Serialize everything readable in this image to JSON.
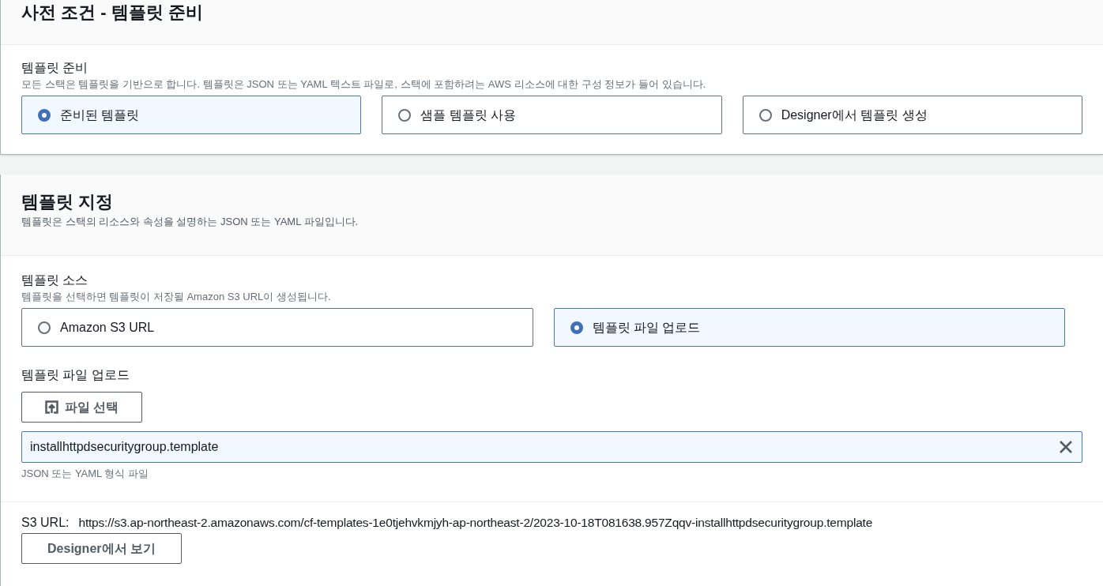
{
  "prerequisite": {
    "title": "사전 조건 - 템플릿 준비",
    "field_label": "템플릿 준비",
    "description": "모든 스택은 템플릿을 기반으로 합니다. 템플릿은 JSON 또는 YAML 텍스트 파일로, 스택에 포함하려는 AWS 리소스에 대한 구성 정보가 들어 있습니다.",
    "options": [
      {
        "label": "준비된 템플릿",
        "selected": true
      },
      {
        "label": "샘플 템플릿 사용",
        "selected": false
      },
      {
        "label": "Designer에서 템플릿 생성",
        "selected": false
      }
    ]
  },
  "specify": {
    "title": "템플릿 지정",
    "subtitle": "템플릿은 스택의 리소스와 속성을 설명하는 JSON 또는 YAML 파일입니다.",
    "source_label": "템플릿 소스",
    "source_description": "템플릿을 선택하면 템플릿이 저장될 Amazon S3 URL이 생성됩니다.",
    "options": [
      {
        "label": "Amazon S3 URL",
        "selected": false
      },
      {
        "label": "템플릿 파일 업로드",
        "selected": true
      }
    ],
    "upload_label": "템플릿 파일 업로드",
    "choose_button": "파일 선택",
    "file_value": "installhttpdsecuritygroup.template",
    "file_hint": "JSON 또는 YAML 형식 파일",
    "s3_label": "S3 URL:",
    "s3_url": "https://s3.ap-northeast-2.amazonaws.com/cf-templates-1e0tjehvkmjyh-ap-northeast-2/2023-10-18T081638.957Zqqv-installhttpdsecuritygroup.template",
    "designer_button": "Designer에서 보기"
  }
}
